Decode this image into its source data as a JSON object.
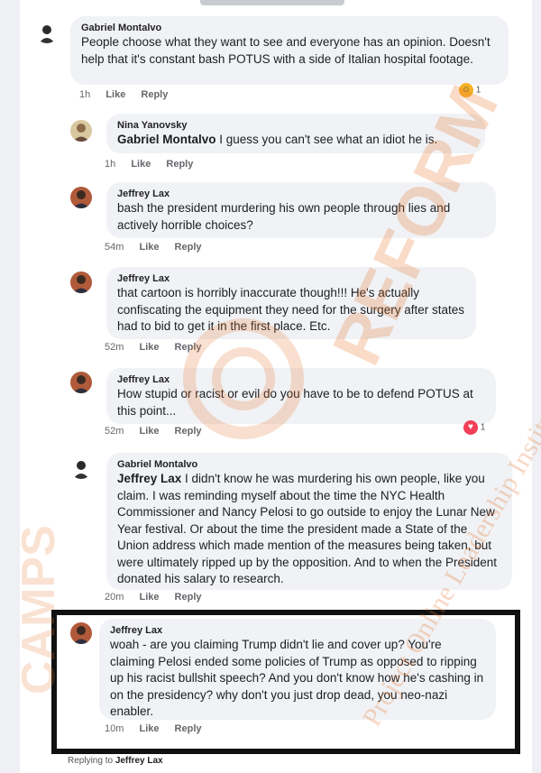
{
  "comments": [
    {
      "author": "Gabriel Montalvo",
      "text": "People choose what they want to see and everyone has an opinion. Doesn't help that it's constant bash POTUS with a side of Italian hospital footage.",
      "time": "1h",
      "like": "Like",
      "reply": "Reply",
      "reaction_count": "1"
    },
    {
      "author": "Nina Yanovsky",
      "mention": "Gabriel Montalvo",
      "text": " I guess you can't see what an idiot he is.",
      "time": "1h",
      "like": "Like",
      "reply": "Reply"
    },
    {
      "author": "Jeffrey Lax",
      "text": "bash the president murdering his own people through lies and actively horrible choices?",
      "time": "54m",
      "like": "Like",
      "reply": "Reply"
    },
    {
      "author": "Jeffrey Lax",
      "text": "that cartoon is horribly inaccurate though!!! He's actually confiscating the equipment they need for the surgery after states had to bid to get it in the first place.  Etc.",
      "time": "52m",
      "like": "Like",
      "reply": "Reply"
    },
    {
      "author": "Jeffrey Lax",
      "text": "How stupid or racist or evil do you have to be to defend POTUS at this point...",
      "time": "52m",
      "like": "Like",
      "reply": "Reply",
      "reaction_count": "1"
    },
    {
      "author": "Gabriel Montalvo",
      "mention": "Jeffrey Lax",
      "text": " I didn't know he was murdering his own people, like you claim. I was reminding myself about the time the NYC Health Commissioner and Nancy Pelosi to go outside to enjoy the Lunar New Year festival. Or about the time the president made a State of the Union address which made mention of the measures being taken, but were ultimately ripped up by the opposition. And to when the President donated his salary to research.",
      "time": "20m",
      "like": "Like",
      "reply": "Reply"
    },
    {
      "author": "Jeffrey Lax",
      "text": "woah - are you claiming Trump didn't lie and cover up?  You're claiming Pelosi ended some policies of Trump as opposed to ripping up his racist bullshit speech?  And you don't know how he's cashing in on the presidency?  why don't you just drop dead, you neo-nazi enabler.",
      "time": "10m",
      "like": "Like",
      "reply": "Reply"
    }
  ],
  "replying": {
    "prefix": "Replying to ",
    "name": "Jeffrey Lax"
  },
  "watermark": {
    "brand": "REFORM",
    "institute": "Project Online Leadership Institute",
    "side": "CAMPS"
  },
  "colors": {
    "bubble": "#f0f2f5",
    "watermark": "#e8732a",
    "love": "#f33e58",
    "haha": "#f7b125"
  }
}
